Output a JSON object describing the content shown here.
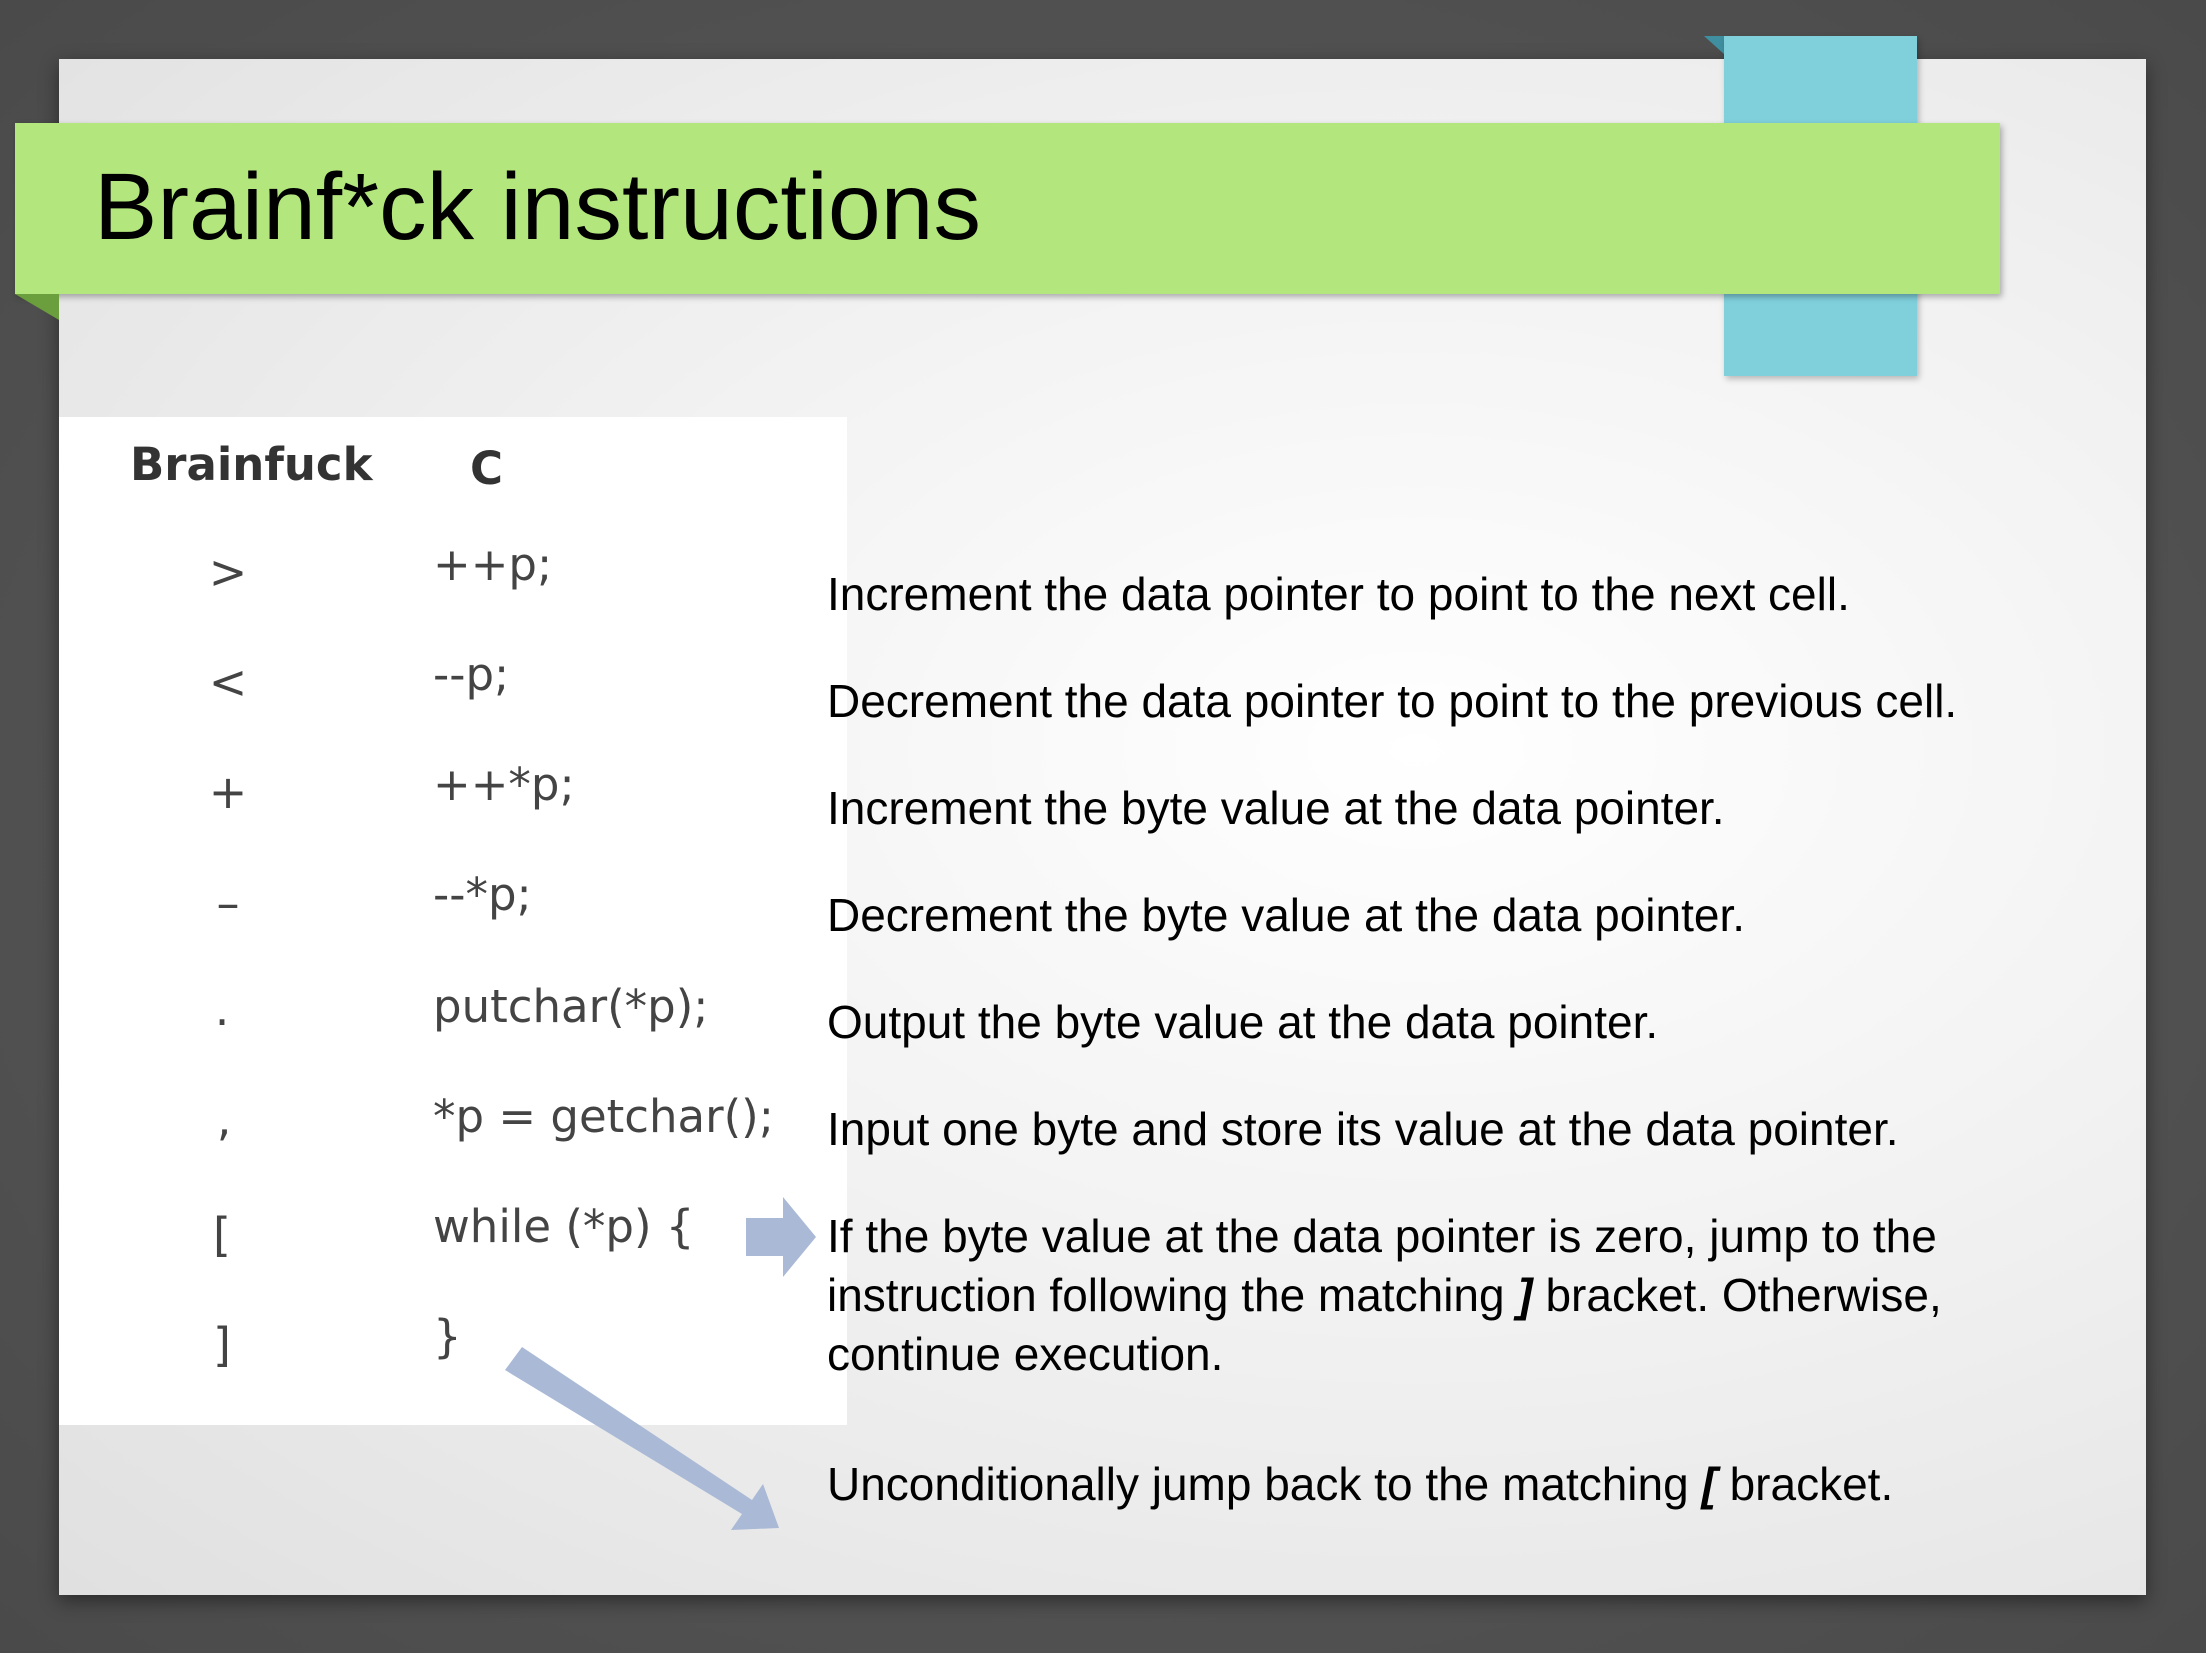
{
  "slide": {
    "title": "Brainf*ck instructions",
    "colors": {
      "title_bar": "#b4e67e",
      "accent_tab": "#80d0dc",
      "arrow": "#a9b9d6"
    }
  },
  "table": {
    "headers": {
      "brainfuck": "Brainfuck",
      "c": "C"
    },
    "rows": [
      {
        "cmd": ">",
        "code": "++p;"
      },
      {
        "cmd": "<",
        "code": "--p;"
      },
      {
        "cmd": "+",
        "code": "++*p;"
      },
      {
        "cmd": "–",
        "code": "--*p;"
      },
      {
        "cmd": ".",
        "code": "putchar(*p);"
      },
      {
        "cmd": ",",
        "code": "*p = getchar();"
      },
      {
        "cmd": "[",
        "code": "while (*p) {"
      },
      {
        "cmd": "]",
        "code": "}"
      }
    ]
  },
  "descriptions": {
    "d1": "Increment the data pointer to point to the next cell.",
    "d2": "Decrement the data pointer to point to the previous cell.",
    "d3": "Increment the byte value at the data pointer.",
    "d4": "Decrement the byte value at the data pointer.",
    "d5": "Output the byte value at the data pointer.",
    "d6": "Input one byte and store its value at the data pointer.",
    "d7": {
      "line1": "If the byte value at the data pointer is zero, jump to the",
      "line2_pre": "instruction following the matching ",
      "line2_bracket": "]",
      "line2_post": " bracket. Otherwise,",
      "line3": "continue execution."
    },
    "d8": {
      "pre": "Unconditionally jump back to the matching ",
      "bracket": "[",
      "post": " bracket."
    }
  },
  "icons": {
    "right_arrow": "right-arrow-icon",
    "diagonal_arrow": "diagonal-arrow-icon"
  }
}
